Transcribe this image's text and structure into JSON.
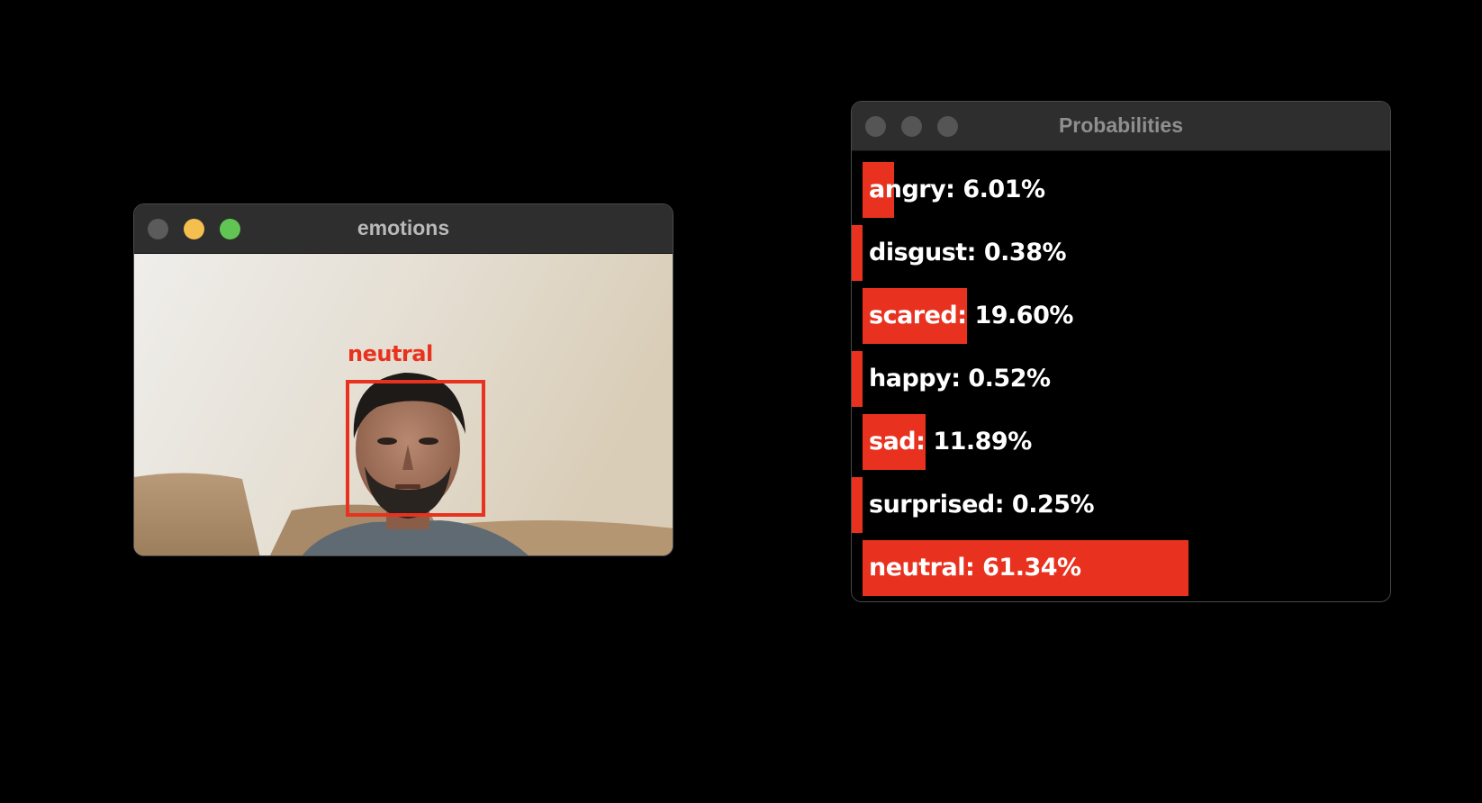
{
  "emotions_window": {
    "title": "emotions",
    "detected_label": "neutral"
  },
  "probabilities_window": {
    "title": "Probabilities",
    "bar_color": "#e8321f",
    "rows": [
      {
        "label": "angry: 6.01%",
        "value": 6.01
      },
      {
        "label": "disgust: 0.38%",
        "value": 0.38
      },
      {
        "label": "scared: 19.60%",
        "value": 19.6
      },
      {
        "label": "happy: 0.52%",
        "value": 0.52
      },
      {
        "label": "sad: 11.89%",
        "value": 11.89
      },
      {
        "label": "surprised: 0.25%",
        "value": 0.25
      },
      {
        "label": "neutral: 61.34%",
        "value": 61.34
      }
    ]
  },
  "colors": {
    "background": "#000000",
    "titlebar": "#2e2e2e",
    "accent_red": "#e8321f",
    "traffic_yellow": "#f4bf4f",
    "traffic_green": "#61c554",
    "traffic_gray": "#5b5b5b"
  },
  "icons": [
    "close-button-icon",
    "minimize-button-icon",
    "zoom-button-icon"
  ]
}
